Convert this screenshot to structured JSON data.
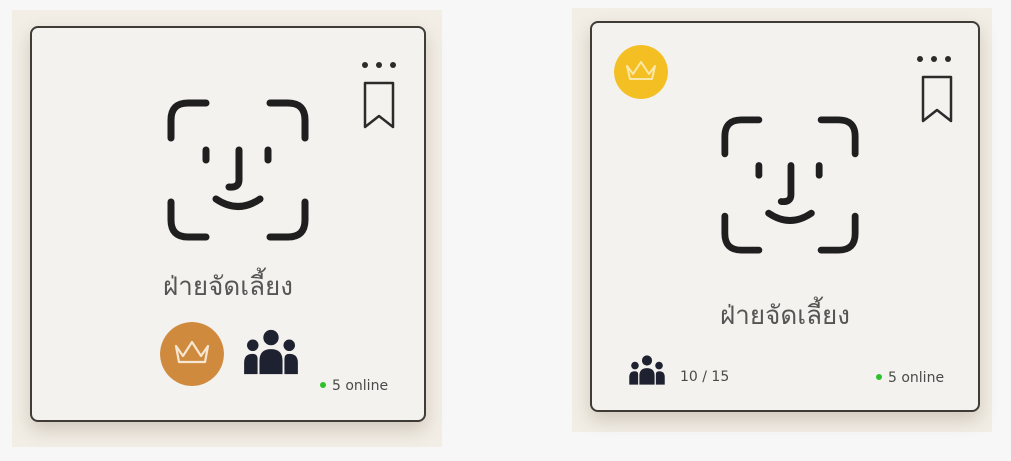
{
  "cards": [
    {
      "title": "ฝ่ายจัดเลี้ยง",
      "online_text": "5 online",
      "badge_color": "#cf8a3e"
    },
    {
      "title": "ฝ่ายจัดเลี้ยง",
      "online_text": "5 online",
      "members_count": "10 / 15",
      "badge_color": "#f4bf23"
    }
  ],
  "colors": {
    "card_background": "#f4f2ee",
    "card_border": "#3f3b37",
    "online_dot": "#2ec12e",
    "icon": "#1f1f1f"
  },
  "icons": [
    "more-options-icon",
    "bookmark-icon",
    "face-id-icon",
    "crown-icon",
    "group-people-icon"
  ]
}
